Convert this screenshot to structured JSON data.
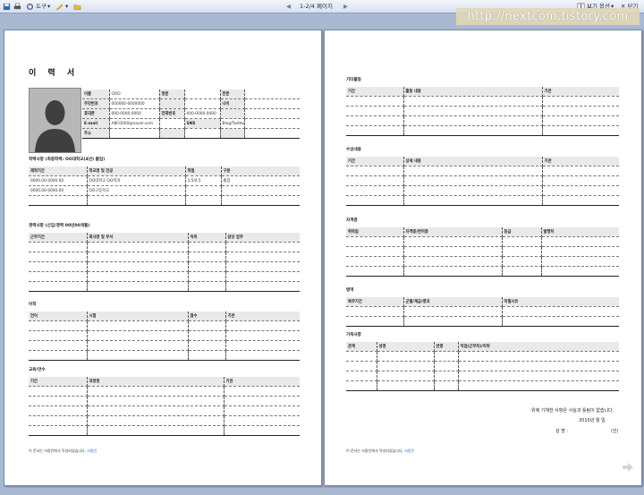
{
  "toolbar": {
    "tools_label": "도구",
    "page_indicator": "1-2/4 페이지",
    "view_options_label": "보기 옵션",
    "close_label": "닫기"
  },
  "watermark": "http://nextcom.tistory.com",
  "page1": {
    "title": "이 력 서",
    "personal": [
      [
        "이름",
        "OOO",
        "영문",
        "",
        "한문",
        ""
      ],
      [
        "주민번호",
        "000000-0000000",
        "",
        "",
        "나이",
        ""
      ],
      [
        "휴대폰",
        "000-0000-0000",
        "전화번호",
        "000-0000-0000",
        "",
        ""
      ],
      [
        "E-mail",
        "ABC0000@naver.com",
        "",
        "SNS",
        "Blog/Twitter/Facebook",
        ""
      ],
      [
        "주소",
        "",
        "",
        "",
        "",
        ""
      ]
    ],
    "edu": {
      "title": "학력사항 (최종학력: OO대학교(4년) 졸업)",
      "rows": [
        [
          "재학기간",
          "학교명 및 전공",
          "학점",
          "구분"
        ],
        [
          "0000.00-0000.00",
          "OO대학교 OO학과",
          "3.5/4.5",
          "졸업"
        ],
        [
          "0000.00-0000.00",
          "OO고등학교",
          "",
          ""
        ],
        [
          "",
          "",
          "",
          ""
        ]
      ]
    },
    "career": {
      "title": "경력사항 (신입/경력 00년00개월)",
      "rows": [
        [
          "근무기간",
          "회사명 및 부서",
          "직위",
          "담당 업무"
        ],
        [
          "",
          "",
          "",
          ""
        ],
        [
          "",
          "",
          "",
          ""
        ],
        [
          "",
          "",
          "",
          ""
        ],
        [
          "",
          "",
          "",
          ""
        ],
        [
          "",
          "",
          "",
          ""
        ]
      ]
    },
    "lang": {
      "title": "어학",
      "rows": [
        [
          "언어",
          "시험",
          "점수",
          "기관"
        ],
        [
          "",
          "",
          "",
          ""
        ],
        [
          "",
          "",
          "",
          ""
        ],
        [
          "",
          "",
          "",
          ""
        ],
        [
          "",
          "",
          "",
          ""
        ]
      ]
    },
    "training": {
      "title": "교육/연수",
      "rows": [
        [
          "기간",
          "과정명",
          "기관"
        ],
        [
          "",
          "",
          ""
        ],
        [
          "",
          "",
          ""
        ],
        [
          "",
          "",
          ""
        ],
        [
          "",
          "",
          ""
        ],
        [
          "",
          "",
          ""
        ]
      ]
    },
    "footer_text": "이 문서는 사람인에서 작성되었습니다.",
    "footer_link": "사람인"
  },
  "page2": {
    "activity": {
      "title": "기타활동",
      "rows": [
        [
          "기간",
          "활동 내용",
          "기관"
        ],
        [
          "",
          "",
          ""
        ],
        [
          "",
          "",
          ""
        ],
        [
          "",
          "",
          ""
        ],
        [
          "",
          "",
          ""
        ]
      ]
    },
    "awards": {
      "title": "수상내용",
      "rows": [
        [
          "기간",
          "상세 내용",
          "기관"
        ],
        [
          "",
          "",
          ""
        ],
        [
          "",
          "",
          ""
        ],
        [
          "",
          "",
          ""
        ],
        [
          "",
          "",
          ""
        ]
      ]
    },
    "cert": {
      "title": "자격증",
      "rows": [
        [
          "취득일",
          "자격증/면허증",
          "등급",
          "발행처"
        ],
        [
          "",
          "",
          "",
          ""
        ],
        [
          "",
          "",
          "",
          ""
        ],
        [
          "",
          "",
          "",
          ""
        ],
        [
          "",
          "",
          "",
          ""
        ]
      ]
    },
    "military": {
      "title": "병역",
      "rows": [
        [
          "복무기간",
          "군별/계급/병과",
          "미필사유"
        ],
        [
          "",
          "",
          ""
        ],
        [
          "",
          "",
          ""
        ]
      ]
    },
    "family": {
      "title": "가족사항",
      "rows": [
        [
          "관계",
          "성명",
          "연령",
          "직업(근무처)/직위"
        ],
        [
          "",
          "",
          "",
          ""
        ],
        [
          "",
          "",
          "",
          ""
        ],
        [
          "",
          "",
          "",
          ""
        ],
        [
          "",
          "",
          "",
          ""
        ]
      ]
    },
    "declaration": "위에 기재한 사항은 사실과 틀림이 없습니다.",
    "date_line": "2010년   월   일",
    "signature_label": "성 명 :",
    "seal": "(인)",
    "footer_text": "이 문서는 사람인에서 작성되었습니다.",
    "footer_link": "사람인"
  }
}
